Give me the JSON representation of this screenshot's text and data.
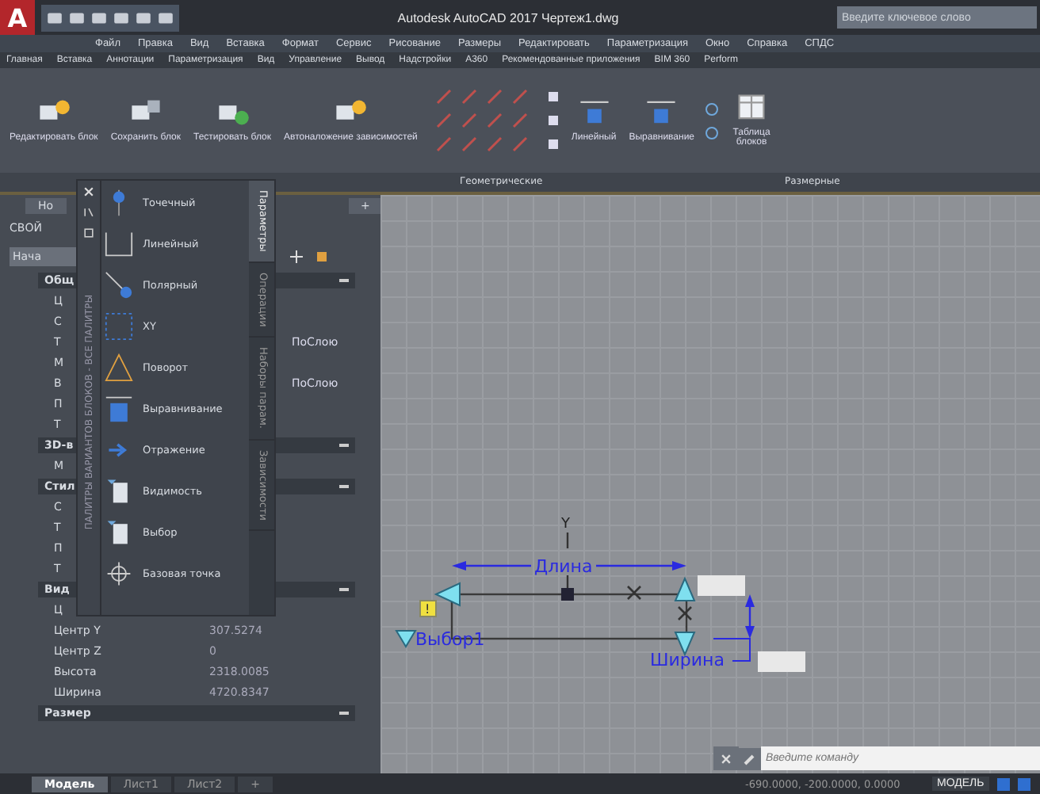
{
  "window": {
    "logo": "A",
    "title": "Autodesk AutoCAD 2017   Чертеж1.dwg",
    "search": {
      "placeholder": "Введите ключевое слово"
    }
  },
  "menu": [
    "Файл",
    "Правка",
    "Вид",
    "Вставка",
    "Формат",
    "Сервис",
    "Рисование",
    "Размеры",
    "Редактировать",
    "Параметризация",
    "Окно",
    "Справка",
    "СПДС"
  ],
  "ribbon_tabs": [
    "Главная",
    "Вставка",
    "Аннотации",
    "Параметризация",
    "Вид",
    "Управление",
    "Вывод",
    "Надстройки",
    "A360",
    "Рекомендованные приложения",
    "BIM 360",
    "Perform"
  ],
  "ribbon": {
    "buttons": [
      {
        "label": "Редактировать блок",
        "kind": "edit"
      },
      {
        "label": "Сохранить блок",
        "kind": "save"
      },
      {
        "label": "Тестировать блок",
        "kind": "test"
      },
      {
        "label": "Автоналожение зависимостей",
        "kind": "auto"
      }
    ],
    "panels": [
      {
        "label": "Геометрические"
      },
      {
        "label": "Размерные"
      }
    ],
    "dimension_buttons": [
      {
        "label": "Линейный"
      },
      {
        "label": "Выравнивание"
      }
    ],
    "table_button": "Таблица блоков"
  },
  "file_tabs": [
    {
      "label": "Но"
    },
    {
      "label": "+"
    }
  ],
  "properties": {
    "title": "СВОЙ",
    "selector": "Нача",
    "sections": [
      {
        "header": "Общ",
        "rows": [
          {
            "label": "Ц"
          },
          {
            "label": "С"
          },
          {
            "label": "Т",
            "value": "ПоСлою"
          },
          {
            "label": "М"
          },
          {
            "label": "В",
            "value": "ПоСлою"
          },
          {
            "label": "П"
          },
          {
            "label": "Т"
          }
        ]
      },
      {
        "header": "3D-в",
        "rows": [
          {
            "label": "М"
          }
        ]
      },
      {
        "header": "Стил",
        "rows": [
          {
            "label": "С"
          },
          {
            "label": "Т"
          },
          {
            "label": "П"
          },
          {
            "label": "Т"
          }
        ]
      },
      {
        "header": "Вид",
        "rows": [
          {
            "label": "Ц"
          },
          {
            "label": "Центр Y",
            "value": "307.5274"
          },
          {
            "label": "Центр Z",
            "value": "0"
          },
          {
            "label": "Высота",
            "value": "2318.0085"
          },
          {
            "label": "Ширина",
            "value": "4720.8347"
          }
        ]
      },
      {
        "header": "Размер"
      }
    ]
  },
  "palette": {
    "title": "ПАЛИТРЫ ВАРИАНТОВ БЛОКОВ - ВСЕ ПАЛИТРЫ",
    "items": [
      {
        "label": "Точечный",
        "kind": "point"
      },
      {
        "label": "Линейный",
        "kind": "linear"
      },
      {
        "label": "Полярный",
        "kind": "polar"
      },
      {
        "label": "XY",
        "kind": "xy"
      },
      {
        "label": "Поворот",
        "kind": "rotate"
      },
      {
        "label": "Выравнивание",
        "kind": "align"
      },
      {
        "label": "Отражение",
        "kind": "flip"
      },
      {
        "label": "Видимость",
        "kind": "visibility"
      },
      {
        "label": "Выбор",
        "kind": "lookup"
      },
      {
        "label": "Базовая точка",
        "kind": "base"
      }
    ],
    "tabs": [
      {
        "label": "Параметры",
        "selected": true
      },
      {
        "label": "Операции",
        "selected": false
      },
      {
        "label": "Наборы парам.",
        "selected": false
      },
      {
        "label": "Зависимости",
        "selected": false
      }
    ]
  },
  "drawing": {
    "axis_label": "Y",
    "length_label": "Длина",
    "width_label": "Ширина",
    "lookup_label": "Выбор1",
    "badge": "!"
  },
  "command_line": {
    "placeholder": "Введите команду"
  },
  "layout_tabs": [
    {
      "label": "Модель",
      "selected": true
    },
    {
      "label": "Лист1",
      "selected": false
    },
    {
      "label": "Лист2",
      "selected": false
    },
    {
      "label": "+",
      "selected": false
    }
  ],
  "status_bar": {
    "coordinates": "-690.0000, -200.0000, 0.0000",
    "space": "МОДЕЛЬ"
  }
}
